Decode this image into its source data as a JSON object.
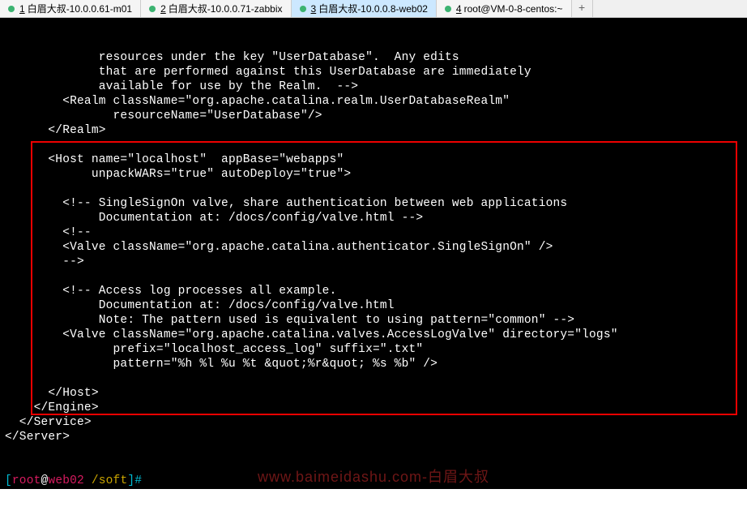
{
  "tabs": [
    {
      "num": "1",
      "label": "白眉大叔-10.0.0.61-m01"
    },
    {
      "num": "2",
      "label": "白眉大叔-10.0.0.71-zabbix"
    },
    {
      "num": "3",
      "label": "白眉大叔-10.0.0.8-web02"
    },
    {
      "num": "4",
      "label": "root@VM-0-8-centos:~"
    }
  ],
  "active_tab_index": 2,
  "tab_add": "+",
  "terminal_lines": [
    "             resources under the key \"UserDatabase\".  Any edits",
    "             that are performed against this UserDatabase are immediately",
    "             available for use by the Realm.  -->",
    "        <Realm className=\"org.apache.catalina.realm.UserDatabaseRealm\"",
    "               resourceName=\"UserDatabase\"/>",
    "      </Realm>",
    "",
    "      <Host name=\"localhost\"  appBase=\"webapps\"",
    "            unpackWARs=\"true\" autoDeploy=\"true\">",
    "",
    "        <!-- SingleSignOn valve, share authentication between web applications",
    "             Documentation at: /docs/config/valve.html -->",
    "        <!--",
    "        <Valve className=\"org.apache.catalina.authenticator.SingleSignOn\" />",
    "        -->",
    "",
    "        <!-- Access log processes all example.",
    "             Documentation at: /docs/config/valve.html",
    "             Note: The pattern used is equivalent to using pattern=\"common\" -->",
    "        <Valve className=\"org.apache.catalina.valves.AccessLogValve\" directory=\"logs\"",
    "               prefix=\"localhost_access_log\" suffix=\".txt\"",
    "               pattern=\"%h %l %u %t &quot;%r&quot; %s %b\" />",
    "",
    "      </Host>",
    "    </Engine>",
    "  </Service>",
    "</Server>"
  ],
  "prompt": {
    "open": "[",
    "user": "root",
    "at": "@",
    "host": "web02",
    "space": " ",
    "path": "/soft",
    "close": "]#"
  },
  "watermark": "www.baimeidashu.com-白眉大叔"
}
